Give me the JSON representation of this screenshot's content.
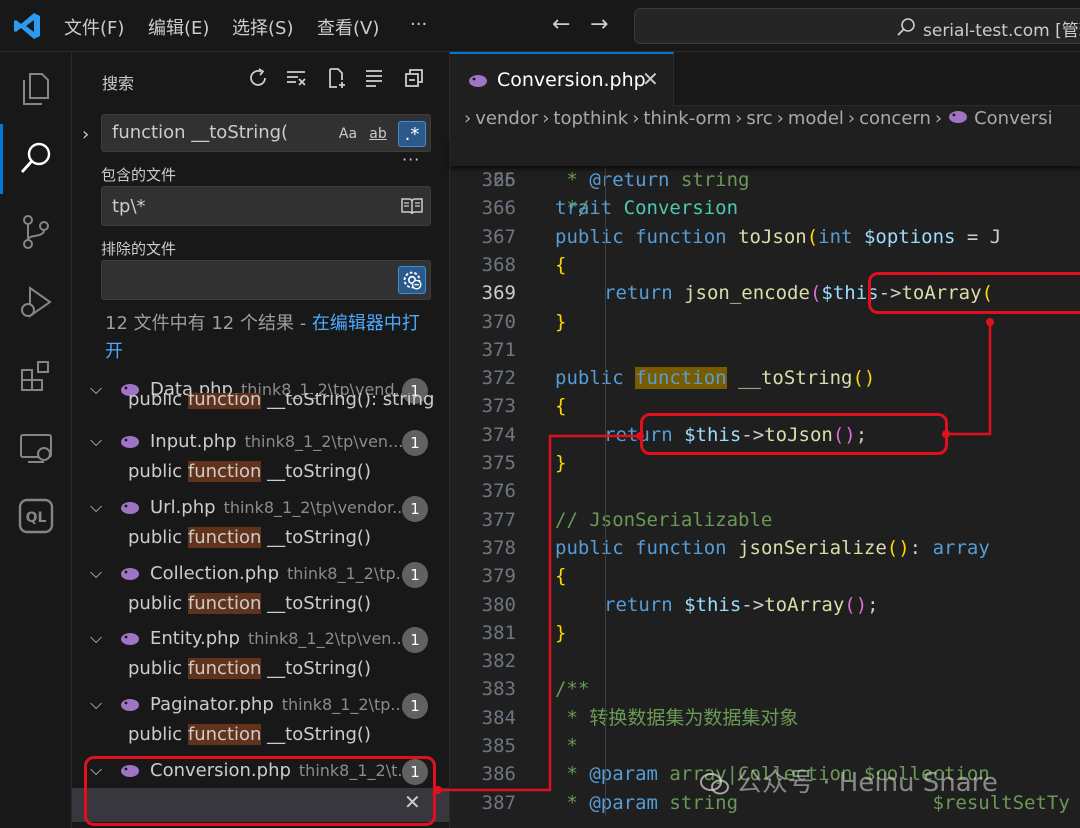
{
  "titlebar": {
    "menus": [
      "文件(F)",
      "编辑(E)",
      "选择(S)",
      "查看(V)",
      "···"
    ],
    "command_center_text": "serial-test.com [管理"
  },
  "sidebar": {
    "title": "搜索",
    "search": {
      "query": "function __toString(",
      "opt_case": "Aa",
      "opt_word": "ab",
      "opt_regex": ".*"
    },
    "more": "···",
    "include_label": "包含的文件",
    "include_value": "tp\\*",
    "exclude_label": "排除的文件",
    "exclude_value": "",
    "summary_text": "12 文件中有 12 个结果 - ",
    "summary_link": "在编辑器中打开",
    "results": [
      {
        "file": "Data.php",
        "path": "think8_1_2\\tp\\vend...",
        "count": "1",
        "line_pre": "public ",
        "line_hl": "function",
        "line_post": " __toString(): string"
      },
      {
        "file": "Input.php",
        "path": "think8_1_2\\tp\\ven...",
        "count": "1",
        "line_pre": "public ",
        "line_hl": "function",
        "line_post": " __toString()"
      },
      {
        "file": "Url.php",
        "path": "think8_1_2\\tp\\vendor...",
        "count": "1",
        "line_pre": "public ",
        "line_hl": "function",
        "line_post": " __toString()"
      },
      {
        "file": "Collection.php",
        "path": "think8_1_2\\tp...",
        "count": "1",
        "line_pre": "public ",
        "line_hl": "function",
        "line_post": " __toString()"
      },
      {
        "file": "Entity.php",
        "path": "think8_1_2\\tp\\ven...",
        "count": "1",
        "line_pre": "public ",
        "line_hl": "function",
        "line_post": " __toString()"
      },
      {
        "file": "Paginator.php",
        "path": "think8_1_2\\tp...",
        "count": "1",
        "line_pre": "public ",
        "line_hl": "function",
        "line_post": " __toString()"
      },
      {
        "file": "Conversion.php",
        "path": "think8_1_2\\t...",
        "count": "1",
        "line_pre": "public ",
        "line_hl": "function",
        "line_post": " __toString()"
      }
    ],
    "close_glyph": "✕"
  },
  "editor": {
    "tab_label": "Conversion.php",
    "tab_close": "✕",
    "breadcrumb": [
      "vendor",
      "topthink",
      "think-orm",
      "src",
      "model",
      "concern",
      "Conversi"
    ],
    "sticky": {
      "num": "26",
      "kw": "trait",
      "cls": "Conversion"
    },
    "lines": [
      {
        "num": "365",
        "c1": " * ",
        "tag": "@return",
        "c2": " string"
      },
      {
        "num": "366",
        "c1": " */"
      },
      {
        "num": "367",
        "kw1": "public",
        "kw2": "function",
        "fn": "toJson",
        "p": "(",
        "kw3": "int",
        "var": "$options",
        "rest": " = J"
      },
      {
        "num": "368",
        "brace": "{"
      },
      {
        "num": "369",
        "ret": "return",
        "fn": "json_encode",
        "p": "(",
        "var": "$this",
        "arrow": "->",
        "fn2": "toArray",
        "p2": "("
      },
      {
        "num": "370",
        "brace": "}"
      },
      {
        "num": "371"
      },
      {
        "num": "372",
        "kw1": "public",
        "kwhl": "function",
        "fn": "__toString",
        "p": "()"
      },
      {
        "num": "373",
        "brace": "{"
      },
      {
        "num": "374",
        "ret": "return",
        "var": "$this",
        "arrow": "->",
        "fn": "toJson",
        "p": "()",
        "semi": ";"
      },
      {
        "num": "375",
        "brace": "}"
      },
      {
        "num": "376"
      },
      {
        "num": "377",
        "cmt": "// JsonSerializable"
      },
      {
        "num": "378",
        "kw1": "public",
        "kw2": "function",
        "fn": "jsonSerialize",
        "p": "()",
        "rest": ": ",
        "kw3": "array"
      },
      {
        "num": "379",
        "brace": "{"
      },
      {
        "num": "380",
        "ret": "return",
        "var": "$this",
        "arrow": "->",
        "fn": "toArray",
        "p": "()",
        "semi": ";"
      },
      {
        "num": "381",
        "brace": "}"
      },
      {
        "num": "382"
      },
      {
        "num": "383",
        "c1": "/**"
      },
      {
        "num": "384",
        "c1": " * 转换数据集为数据集对象"
      },
      {
        "num": "385",
        "c1": " *"
      },
      {
        "num": "386",
        "c1": " * ",
        "tag": "@param",
        "c2": " array|Collection $collection"
      },
      {
        "num": "387",
        "c1": " * ",
        "tag": "@param",
        "c2": " string                 $resultSetTy"
      }
    ]
  },
  "watermark": "公众号 · Heihu Share",
  "colors": {
    "accent": "#0078d4",
    "annotation": "#e0101f",
    "match_highlight": "#62331c"
  }
}
